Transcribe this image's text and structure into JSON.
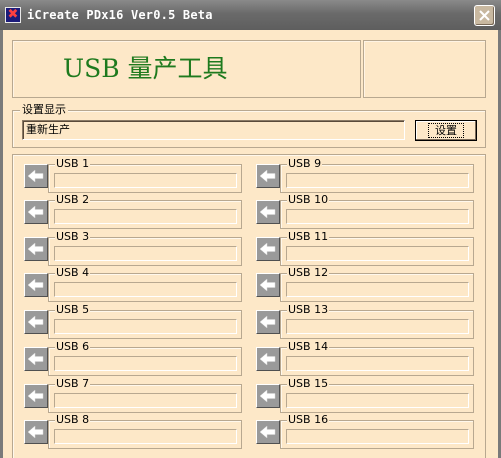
{
  "window": {
    "title": "iCreate PDx16 Ver0.5 Beta",
    "close_icon": "close-icon",
    "app_icon": "app-icon"
  },
  "header": {
    "title": "USB 量产工具",
    "title_color": "#1e7a1e"
  },
  "settings": {
    "legend": "设置显示",
    "value": "重新生产",
    "button_label": "设置"
  },
  "usb_ports": {
    "left": [
      {
        "label": "USB 1",
        "status": ""
      },
      {
        "label": "USB 2",
        "status": ""
      },
      {
        "label": "USB 3",
        "status": ""
      },
      {
        "label": "USB 4",
        "status": ""
      },
      {
        "label": "USB 5",
        "status": ""
      },
      {
        "label": "USB 6",
        "status": ""
      },
      {
        "label": "USB 7",
        "status": ""
      },
      {
        "label": "USB 8",
        "status": ""
      }
    ],
    "right": [
      {
        "label": "USB 9",
        "status": ""
      },
      {
        "label": "USB 10",
        "status": ""
      },
      {
        "label": "USB 11",
        "status": ""
      },
      {
        "label": "USB 12",
        "status": ""
      },
      {
        "label": "USB 13",
        "status": ""
      },
      {
        "label": "USB 14",
        "status": ""
      },
      {
        "label": "USB 15",
        "status": ""
      },
      {
        "label": "USB 16",
        "status": ""
      }
    ],
    "port_icon": "left-arrow-icon"
  },
  "colors": {
    "background": "#fde8c8",
    "titlebar": "#6a6a6a",
    "port_button": "#9a9a9a"
  }
}
